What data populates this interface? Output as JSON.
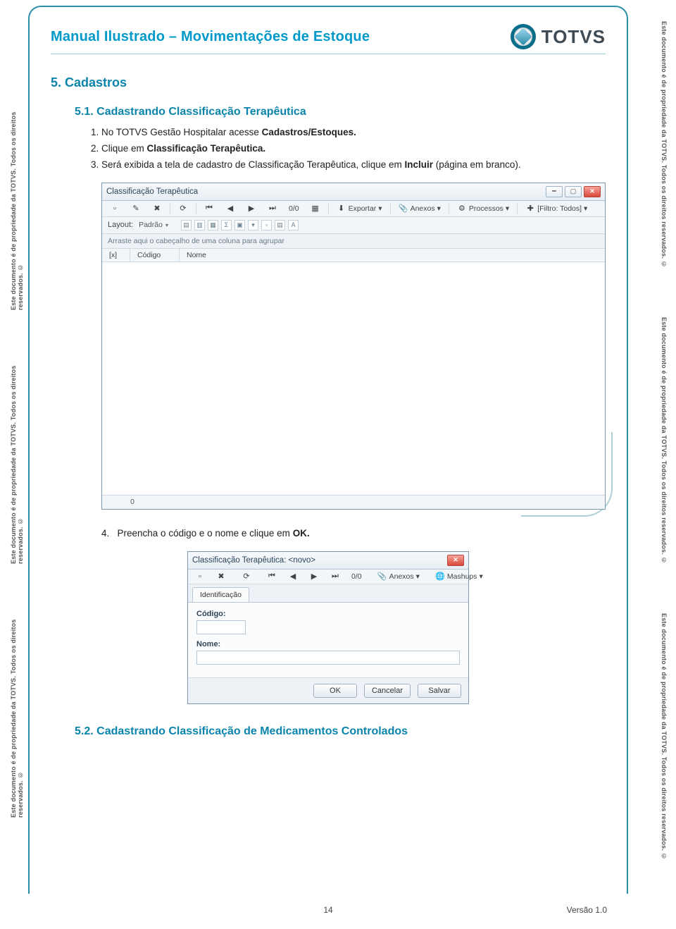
{
  "side_text": "Este documento é de propriedade da TOTVS. Todos os direitos reservados. ©",
  "header": {
    "doc_title": "Manual Ilustrado – Movimentações de Estoque",
    "brand": "TOTVS"
  },
  "section5": {
    "title": "5.  Cadastros",
    "sub1": {
      "title": "5.1. Cadastrando Classificação Terapêutica",
      "steps": {
        "s1_pre": "No TOTVS Gestão Hospitalar acesse ",
        "s1_bold": "Cadastros/Estoques.",
        "s2_pre": "Clique em ",
        "s2_bold": "Classificação Terapêutica.",
        "s3_pre": "Será exibida a tela de cadastro de Classificação Terapêutica, clique em ",
        "s3_bold": "Incluir ",
        "s3_post": "(página em branco).",
        "s4_pre": "Preencha o código e o nome e clique em ",
        "s4_bold": "OK."
      }
    },
    "sub2": {
      "title": "5.2. Cadastrando Classificação de Medicamentos Controlados"
    }
  },
  "screenshot1": {
    "title": "Classificação Terapêutica",
    "pager": "0/0",
    "export": "Exportar",
    "anexos": "Anexos",
    "processos": "Processos",
    "filtro": "[Filtro: Todos]",
    "layout_label": "Layout:",
    "layout_value": "Padrão",
    "group_hint": "Arraste aqui o cabeçalho de uma coluna para agrupar",
    "columns": {
      "sel": "[x]",
      "codigo": "Código",
      "nome": "Nome"
    },
    "footer": "0"
  },
  "screenshot2": {
    "title": "Classificação Terapêutica: <novo>",
    "pager": "0/0",
    "anexos": "Anexos",
    "mashups": "Mashups",
    "tab": "Identificação",
    "codigo_label": "Código:",
    "nome_label": "Nome:",
    "ok": "OK",
    "cancelar": "Cancelar",
    "salvar": "Salvar"
  },
  "footer": {
    "page": "14",
    "version": "Versão 1.0"
  }
}
